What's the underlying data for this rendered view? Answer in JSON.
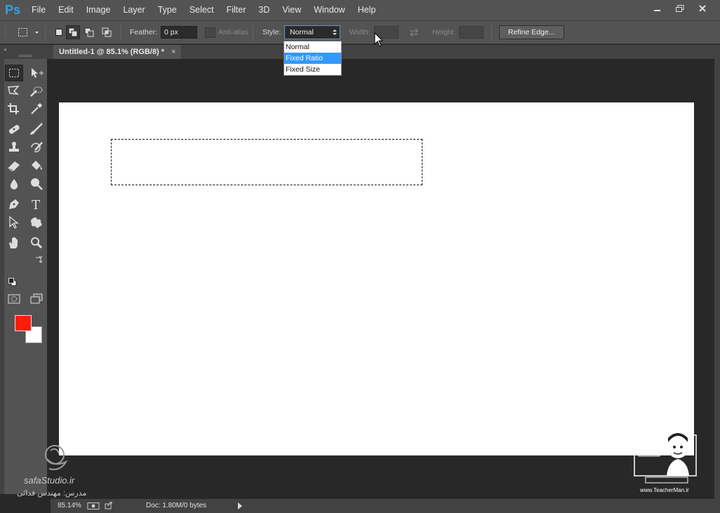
{
  "app": {
    "logo": "Ps"
  },
  "menu": [
    "File",
    "Edit",
    "Image",
    "Layer",
    "Type",
    "Select",
    "Filter",
    "3D",
    "View",
    "Window",
    "Help"
  ],
  "options": {
    "feather_label": "Feather:",
    "feather_value": "0 px",
    "antialias_label": "Anti-alias",
    "style_label": "Style:",
    "style_value": "Normal",
    "width_label": "Width:",
    "height_label": "Height:",
    "refine_edge_label": "Refine Edge..."
  },
  "style_dropdown": {
    "options": [
      "Normal",
      "Fixed Ratio",
      "Fixed Size"
    ],
    "highlighted": "Fixed Ratio"
  },
  "document_tab": {
    "title": "Untitled-1 @ 85.1% (RGB/8) *",
    "close": "×"
  },
  "status": {
    "zoom": "85.14%",
    "doc_info": "Doc: 1.80M/0 bytes"
  },
  "colors": {
    "foreground": "#ff1d0a",
    "background": "#ffffff",
    "accent": "#3399ff"
  },
  "watermarks": {
    "left_site": "safaStudio.ir",
    "left_instructor": "مدرس: مهندس فدائی",
    "right_site": "www.TeacherMan.ir"
  },
  "tools": [
    "rect-marquee-icon",
    "move-icon",
    "polygon-lasso-icon",
    "quick-select-icon",
    "crop-icon",
    "eyedropper-icon",
    "healing-brush-icon",
    "brush-icon",
    "clone-stamp-icon",
    "history-brush-icon",
    "eraser-icon",
    "paint-bucket-icon",
    "blur-icon",
    "dodge-icon",
    "pen-icon",
    "type-icon",
    "path-select-icon",
    "custom-shape-icon",
    "hand-icon",
    "zoom-icon",
    "quick-mask-icon",
    "screen-mode-icon"
  ]
}
